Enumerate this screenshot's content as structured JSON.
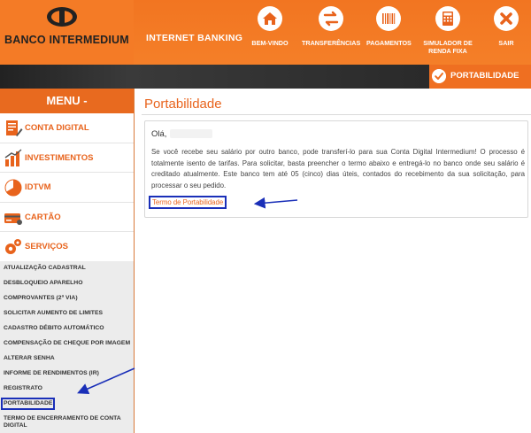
{
  "header": {
    "brand": "BANCO INTERMEDIUM",
    "internet_banking": "INTERNET BANKING",
    "nav": [
      {
        "label": "BEM-VINDO",
        "icon": "home-icon"
      },
      {
        "label": "TRANSFERÊNCIAS",
        "icon": "transfer-arrows-icon"
      },
      {
        "label": "PAGAMENTOS",
        "icon": "barcode-icon"
      },
      {
        "label": "SIMULADOR DE RENDA FIXA",
        "icon": "calculator-icon"
      },
      {
        "label": "SAIR",
        "icon": "close-icon"
      }
    ]
  },
  "breadcrumb": {
    "label": "PORTABILIDADE",
    "icon": "check-circle-icon"
  },
  "sidebar": {
    "menu_title": "MENU -",
    "sections": [
      {
        "label": "CONTA DIGITAL",
        "icon": "document-icon"
      },
      {
        "label": "INVESTIMENTOS",
        "icon": "bar-chart-icon"
      },
      {
        "label": "IDTVM",
        "icon": "pie-chart-icon"
      },
      {
        "label": "CARTÃO",
        "icon": "credit-card-icon"
      },
      {
        "label": "SERVIÇOS",
        "icon": "gears-icon"
      }
    ],
    "services": [
      "ATUALIZAÇÃO CADASTRAL",
      "DESBLOQUEIO APARELHO",
      "COMPROVANTES (2ª VIA)",
      "SOLICITAR AUMENTO DE LIMITES",
      "CADASTRO DÉBITO AUTOMÁTICO",
      "COMPENSAÇÃO DE CHEQUE POR IMAGEM",
      "ALTERAR SENHA",
      "INFORME DE RENDIMENTOS (IR)",
      "REGISTRATO",
      "PORTABILIDADE",
      "TERMO DE ENCERRAMENTO DE CONTA DIGITAL"
    ]
  },
  "main": {
    "title": "Portabilidade",
    "greeting": "Olá,",
    "paragraph": "Se você recebe seu salário por outro banco, pode transferí-lo para sua Conta Digital Intermedium! O processo é totalmente isento de tarifas. Para solicitar, basta preencher o termo abaixo e entregá-lo no banco onde seu salário é creditado atualmente. Este banco tem até 05 (cinco) dias úteis, contados do recebimento da sua solicitação, para processar o seu pedido.",
    "link": "Termo de Portabilidade"
  },
  "colors": {
    "accent": "#e8631c",
    "highlight": "#1a2fb8",
    "dark_bar": "#2a2a2a"
  }
}
